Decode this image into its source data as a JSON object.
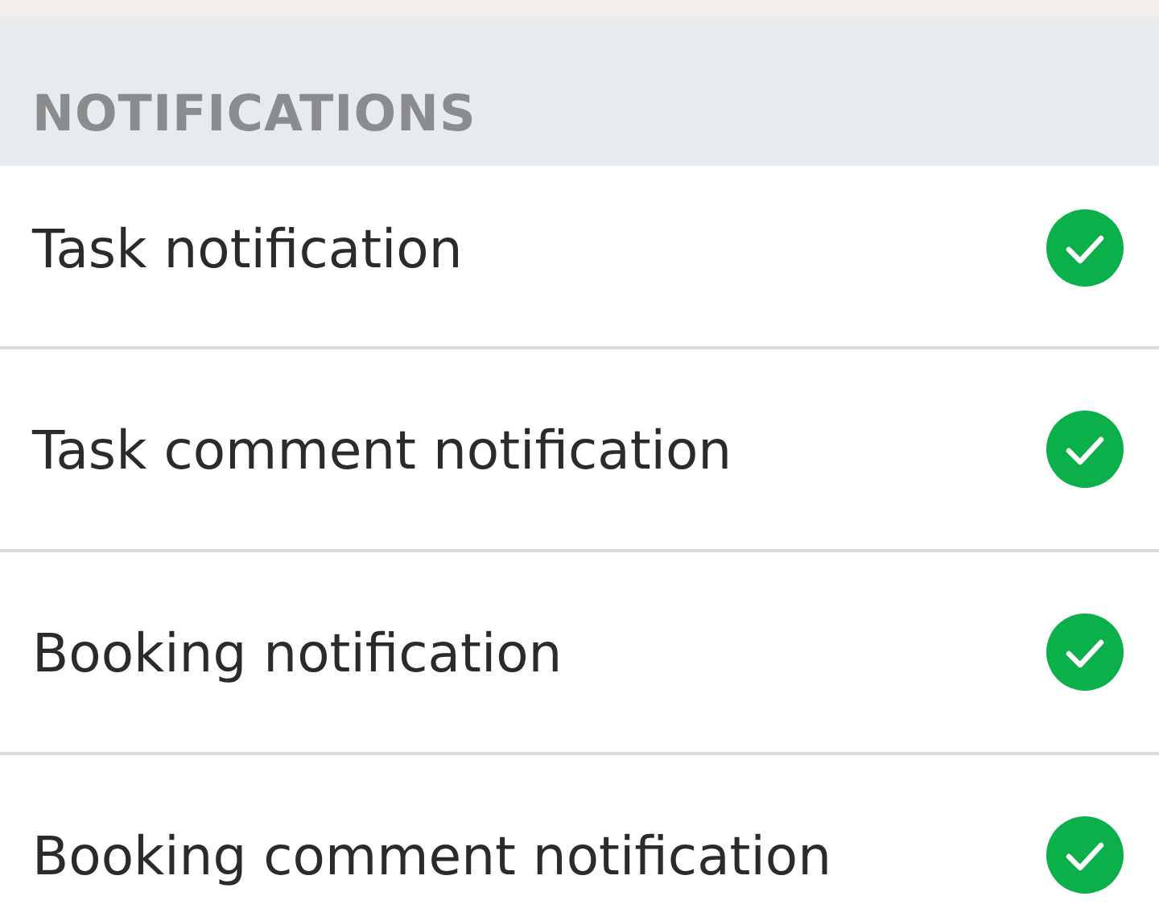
{
  "section": {
    "title": "NOTIFICATIONS"
  },
  "items": [
    {
      "label": "Task notification",
      "checked": true
    },
    {
      "label": "Task comment notification",
      "checked": true
    },
    {
      "label": "Booking notification",
      "checked": true
    },
    {
      "label": "Booking comment notification",
      "checked": true
    }
  ]
}
